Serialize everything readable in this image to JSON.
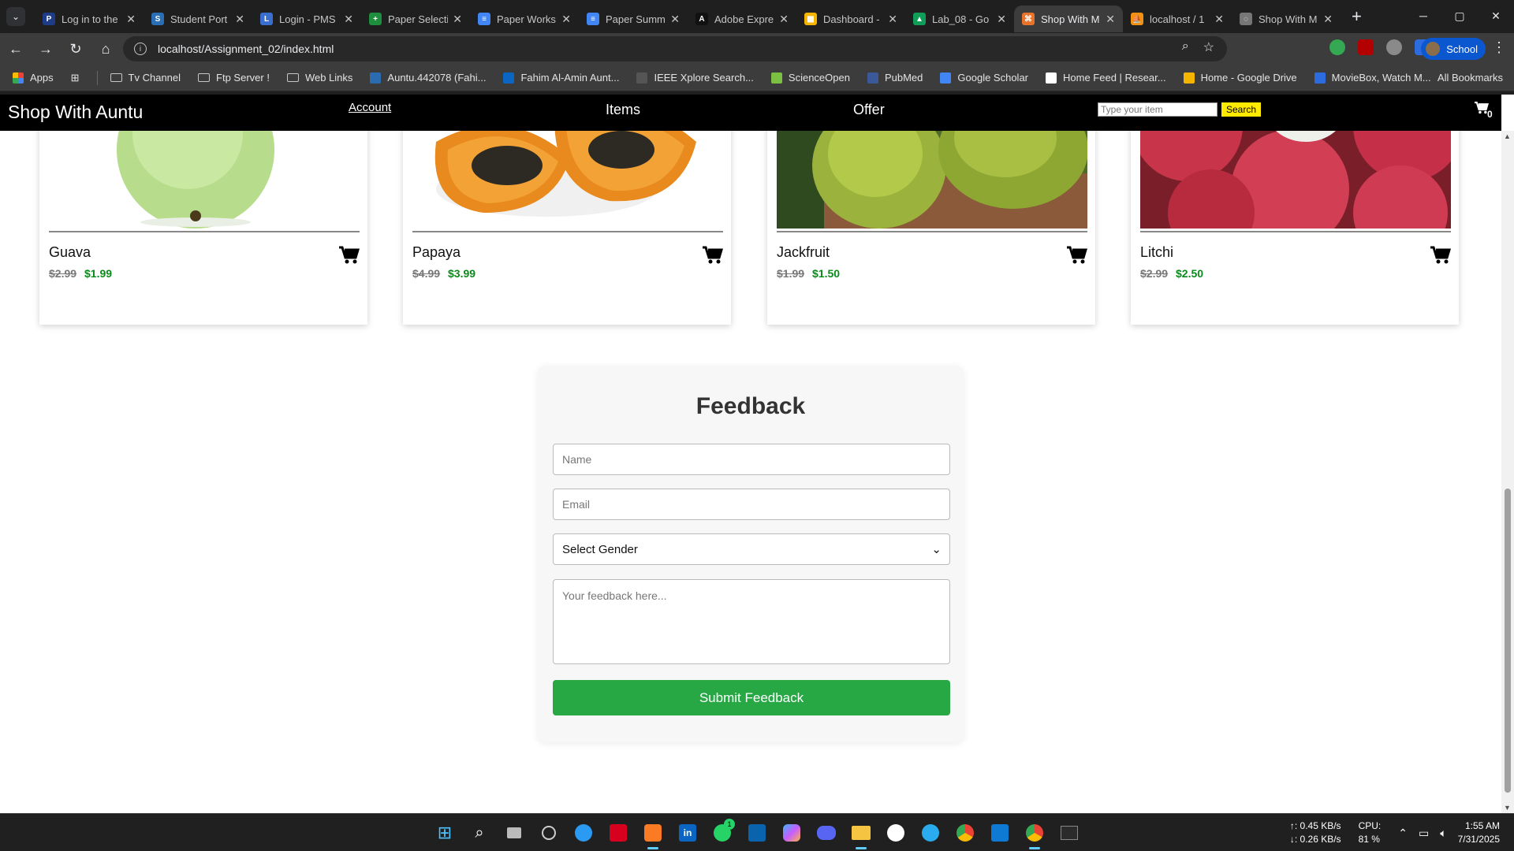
{
  "browser": {
    "tabs": [
      {
        "title": "Log in to the",
        "color": "#1f3c88",
        "glyph": "P"
      },
      {
        "title": "Student Port",
        "color": "#2a6fb5",
        "glyph": "S"
      },
      {
        "title": "Login - PMS",
        "color": "#3b6fcf",
        "glyph": "L"
      },
      {
        "title": "Paper Selecti",
        "color": "#1e8e3e",
        "glyph": "+"
      },
      {
        "title": "Paper Works",
        "color": "#4285f4",
        "glyph": "≡"
      },
      {
        "title": "Paper Summ",
        "color": "#4285f4",
        "glyph": "≡"
      },
      {
        "title": "Adobe Expre",
        "color": "#111111",
        "glyph": "A"
      },
      {
        "title": "Dashboard -",
        "color": "#f4b400",
        "glyph": "▦"
      },
      {
        "title": "Lab_08 - Go",
        "color": "#0f9d58",
        "glyph": "▲"
      },
      {
        "title": "Shop With M",
        "color": "#e8732a",
        "glyph": "⌘"
      },
      {
        "title": "localhost / 1",
        "color": "#f29111",
        "glyph": "⛵"
      },
      {
        "title": "Shop With M",
        "color": "#777777",
        "glyph": "◌"
      }
    ],
    "active_tab_index": 9,
    "new_tab": "+",
    "window_controls": {
      "minimize": "─",
      "maximize": "▢",
      "close": "✕"
    },
    "url": "localhost/Assignment_02/index.html",
    "profile_label": "School",
    "bookmarks": [
      {
        "label": "Apps",
        "kind": "apps"
      },
      {
        "label": "Tv Channel",
        "kind": "folder"
      },
      {
        "label": "Ftp Server !",
        "kind": "folder"
      },
      {
        "label": "Web Links",
        "kind": "folder"
      },
      {
        "label": "Auntu.442078 (Fahi...",
        "kind": "site",
        "color": "#2b6cb0"
      },
      {
        "label": "Fahim Al-Amin Aunt...",
        "kind": "site",
        "color": "#0a66c2"
      },
      {
        "label": "IEEE Xplore Search...",
        "kind": "site",
        "color": "#555555"
      },
      {
        "label": "ScienceOpen",
        "kind": "site",
        "color": "#7bc043"
      },
      {
        "label": "PubMed",
        "kind": "site",
        "color": "#3b5998"
      },
      {
        "label": "Google Scholar",
        "kind": "site",
        "color": "#4285f4"
      },
      {
        "label": "Home Feed | Resear...",
        "kind": "site",
        "color": "#ffffff"
      },
      {
        "label": "Home - Google Drive",
        "kind": "site",
        "color": "#f4b400"
      },
      {
        "label": "MovieBox, Watch M...",
        "kind": "site",
        "color": "#2d6cdf"
      }
    ],
    "all_bookmarks": "All Bookmarks"
  },
  "site": {
    "brand": "Shop With Auntu",
    "nav": {
      "account": "Account",
      "items": "Items",
      "offer": "Offer"
    },
    "search_placeholder": "Type your item",
    "search_button": "Search",
    "cart_count": "0"
  },
  "products": [
    {
      "name": "Guava",
      "old_price": "$2.99",
      "new_price": "$1.99",
      "image": "guava"
    },
    {
      "name": "Papaya",
      "old_price": "$4.99",
      "new_price": "$3.99",
      "image": "papaya"
    },
    {
      "name": "Jackfruit",
      "old_price": "$1.99",
      "new_price": "$1.50",
      "image": "jackfruit"
    },
    {
      "name": "Litchi",
      "old_price": "$2.99",
      "new_price": "$2.50",
      "image": "litchi"
    }
  ],
  "feedback": {
    "title": "Feedback",
    "name_placeholder": "Name",
    "email_placeholder": "Email",
    "gender_selected": "Select Gender",
    "textarea_placeholder": "Your feedback here...",
    "submit": "Submit Feedback"
  },
  "taskbar": {
    "net_up": "↑: 0.45 KB/s",
    "net_down": "↓: 0.26 KB/s",
    "cpu_label": "CPU:",
    "cpu_value": "81 %",
    "time": "1:55 AM",
    "date": "7/31/2025",
    "whatsapp_badge": "1"
  }
}
